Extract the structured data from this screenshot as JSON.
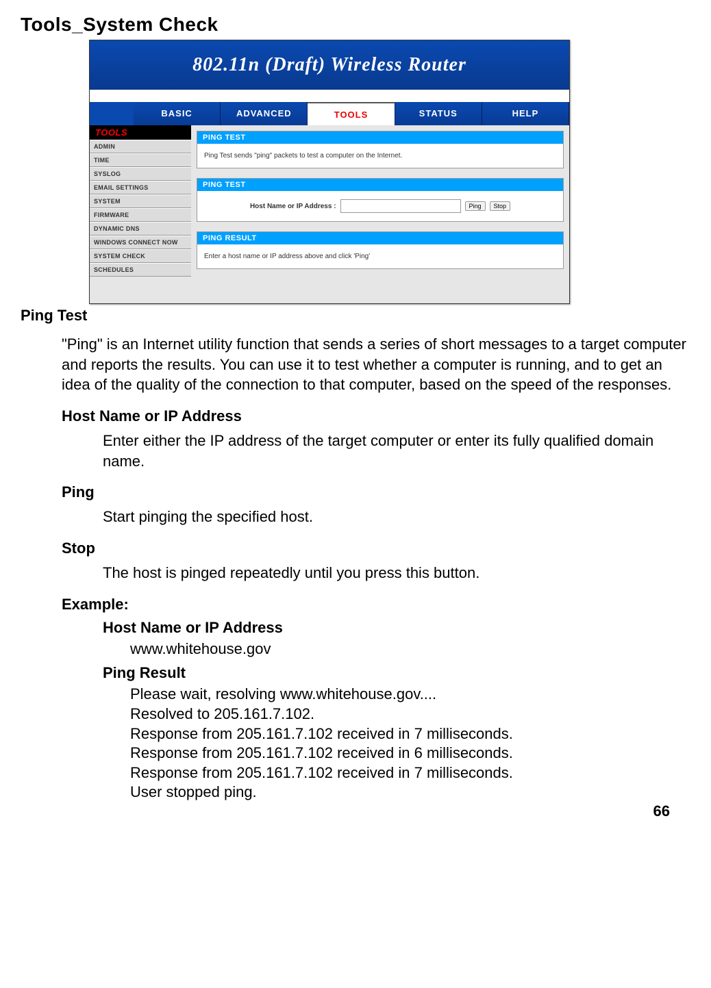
{
  "doc": {
    "title": "Tools_System Check",
    "page_number": "66"
  },
  "router": {
    "banner": "802.11n (Draft) Wireless Router",
    "nav": {
      "basic": "BASIC",
      "advanced": "ADVANCED",
      "tools": "TOOLS",
      "status": "STATUS",
      "help": "HELP"
    },
    "sidebar": {
      "header": "TOOLS",
      "items": [
        "ADMIN",
        "TIME",
        "SYSLOG",
        "EMAIL SETTINGS",
        "SYSTEM",
        "FIRMWARE",
        "DYNAMIC DNS",
        "WINDOWS CONNECT NOW",
        "SYSTEM CHECK",
        "SCHEDULES"
      ]
    },
    "panel_intro": {
      "header": "PING TEST",
      "text": "Ping Test sends \"ping\" packets to test a computer on the Internet."
    },
    "panel_form": {
      "header": "PING TEST",
      "label": "Host Name or IP Address :",
      "ping_btn": "Ping",
      "stop_btn": "Stop",
      "input_value": ""
    },
    "panel_result": {
      "header": "PING RESULT",
      "text": "Enter a host name or IP address above and click 'Ping'"
    }
  },
  "help": {
    "ping_test_heading": "Ping Test",
    "ping_test_body": "\"Ping\" is an Internet utility function that sends a series of short messages to a target computer and reports the results. You can use it to test whether a computer is running, and to get an idea of the quality of the connection to that computer, based on the speed of the responses.",
    "host_heading": "Host Name or IP Address",
    "host_body": "Enter either the IP address of the target computer or enter its fully qualified domain name.",
    "ping_heading": "Ping",
    "ping_body": "Start pinging the specified host.",
    "stop_heading": "Stop",
    "stop_body": "The host is pinged repeatedly until you press this button.",
    "example_heading": "Example:",
    "example_host_heading": "Host Name or IP Address",
    "example_host_value": "www.whitehouse.gov",
    "example_result_heading": "Ping Result",
    "example_lines": [
      "Please wait, resolving www.whitehouse.gov....",
      "Resolved to 205.161.7.102.",
      "Response from 205.161.7.102 received in 7 milliseconds.",
      "Response from 205.161.7.102 received in 6 milliseconds.",
      "Response from 205.161.7.102 received in 7 milliseconds.",
      "User stopped ping."
    ]
  }
}
